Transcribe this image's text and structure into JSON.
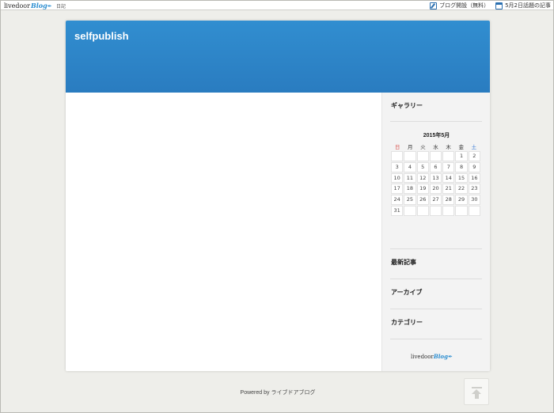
{
  "topbar": {
    "logo_text": "livedoor",
    "logo_blog": "Blog",
    "diary_link": "日記",
    "open_blog": "ブログ開設（無料）",
    "topic_articles": "5月2日話題の記事"
  },
  "site": {
    "title": "selfpublish"
  },
  "sidebar": {
    "gallery": "ギャラリー",
    "calendar_title": "2015年5月",
    "weekdays": [
      "日",
      "月",
      "火",
      "水",
      "木",
      "金",
      "土"
    ],
    "days": [
      "",
      "",
      "",
      "",
      "",
      "1",
      "2",
      "3",
      "4",
      "5",
      "6",
      "7",
      "8",
      "9",
      "10",
      "11",
      "12",
      "13",
      "14",
      "15",
      "16",
      "17",
      "18",
      "19",
      "20",
      "21",
      "22",
      "23",
      "24",
      "25",
      "26",
      "27",
      "28",
      "29",
      "30",
      "31",
      "",
      "",
      "",
      "",
      "",
      ""
    ],
    "latest": "最新記事",
    "archive": "アーカイブ",
    "category": "カテゴリー",
    "logo_text": "livedoor",
    "logo_blog": "Blog"
  },
  "footer": {
    "powered": "Powered by ライブドアブログ"
  },
  "colors": {
    "header": "#2a84c8",
    "sunday": "#d9534f",
    "saturday": "#3a7bd5"
  }
}
